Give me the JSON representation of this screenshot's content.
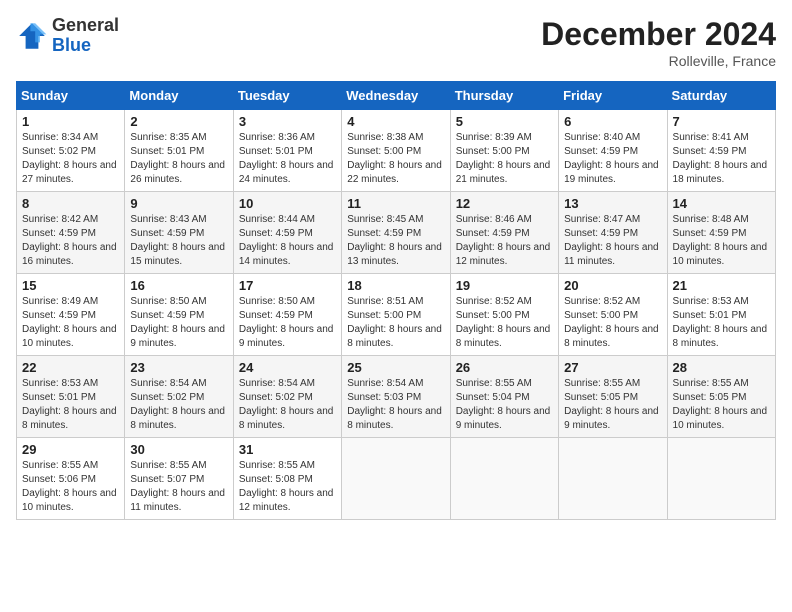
{
  "header": {
    "logo_line1": "General",
    "logo_line2": "Blue",
    "month": "December 2024",
    "location": "Rolleville, France"
  },
  "weekdays": [
    "Sunday",
    "Monday",
    "Tuesday",
    "Wednesday",
    "Thursday",
    "Friday",
    "Saturday"
  ],
  "weeks": [
    [
      {
        "day": "1",
        "sunrise": "8:34 AM",
        "sunset": "5:02 PM",
        "daylight": "8 hours and 27 minutes."
      },
      {
        "day": "2",
        "sunrise": "8:35 AM",
        "sunset": "5:01 PM",
        "daylight": "8 hours and 26 minutes."
      },
      {
        "day": "3",
        "sunrise": "8:36 AM",
        "sunset": "5:01 PM",
        "daylight": "8 hours and 24 minutes."
      },
      {
        "day": "4",
        "sunrise": "8:38 AM",
        "sunset": "5:00 PM",
        "daylight": "8 hours and 22 minutes."
      },
      {
        "day": "5",
        "sunrise": "8:39 AM",
        "sunset": "5:00 PM",
        "daylight": "8 hours and 21 minutes."
      },
      {
        "day": "6",
        "sunrise": "8:40 AM",
        "sunset": "4:59 PM",
        "daylight": "8 hours and 19 minutes."
      },
      {
        "day": "7",
        "sunrise": "8:41 AM",
        "sunset": "4:59 PM",
        "daylight": "8 hours and 18 minutes."
      }
    ],
    [
      {
        "day": "8",
        "sunrise": "8:42 AM",
        "sunset": "4:59 PM",
        "daylight": "8 hours and 16 minutes."
      },
      {
        "day": "9",
        "sunrise": "8:43 AM",
        "sunset": "4:59 PM",
        "daylight": "8 hours and 15 minutes."
      },
      {
        "day": "10",
        "sunrise": "8:44 AM",
        "sunset": "4:59 PM",
        "daylight": "8 hours and 14 minutes."
      },
      {
        "day": "11",
        "sunrise": "8:45 AM",
        "sunset": "4:59 PM",
        "daylight": "8 hours and 13 minutes."
      },
      {
        "day": "12",
        "sunrise": "8:46 AM",
        "sunset": "4:59 PM",
        "daylight": "8 hours and 12 minutes."
      },
      {
        "day": "13",
        "sunrise": "8:47 AM",
        "sunset": "4:59 PM",
        "daylight": "8 hours and 11 minutes."
      },
      {
        "day": "14",
        "sunrise": "8:48 AM",
        "sunset": "4:59 PM",
        "daylight": "8 hours and 10 minutes."
      }
    ],
    [
      {
        "day": "15",
        "sunrise": "8:49 AM",
        "sunset": "4:59 PM",
        "daylight": "8 hours and 10 minutes."
      },
      {
        "day": "16",
        "sunrise": "8:50 AM",
        "sunset": "4:59 PM",
        "daylight": "8 hours and 9 minutes."
      },
      {
        "day": "17",
        "sunrise": "8:50 AM",
        "sunset": "4:59 PM",
        "daylight": "8 hours and 9 minutes."
      },
      {
        "day": "18",
        "sunrise": "8:51 AM",
        "sunset": "5:00 PM",
        "daylight": "8 hours and 8 minutes."
      },
      {
        "day": "19",
        "sunrise": "8:52 AM",
        "sunset": "5:00 PM",
        "daylight": "8 hours and 8 minutes."
      },
      {
        "day": "20",
        "sunrise": "8:52 AM",
        "sunset": "5:00 PM",
        "daylight": "8 hours and 8 minutes."
      },
      {
        "day": "21",
        "sunrise": "8:53 AM",
        "sunset": "5:01 PM",
        "daylight": "8 hours and 8 minutes."
      }
    ],
    [
      {
        "day": "22",
        "sunrise": "8:53 AM",
        "sunset": "5:01 PM",
        "daylight": "8 hours and 8 minutes."
      },
      {
        "day": "23",
        "sunrise": "8:54 AM",
        "sunset": "5:02 PM",
        "daylight": "8 hours and 8 minutes."
      },
      {
        "day": "24",
        "sunrise": "8:54 AM",
        "sunset": "5:02 PM",
        "daylight": "8 hours and 8 minutes."
      },
      {
        "day": "25",
        "sunrise": "8:54 AM",
        "sunset": "5:03 PM",
        "daylight": "8 hours and 8 minutes."
      },
      {
        "day": "26",
        "sunrise": "8:55 AM",
        "sunset": "5:04 PM",
        "daylight": "8 hours and 9 minutes."
      },
      {
        "day": "27",
        "sunrise": "8:55 AM",
        "sunset": "5:05 PM",
        "daylight": "8 hours and 9 minutes."
      },
      {
        "day": "28",
        "sunrise": "8:55 AM",
        "sunset": "5:05 PM",
        "daylight": "8 hours and 10 minutes."
      }
    ],
    [
      {
        "day": "29",
        "sunrise": "8:55 AM",
        "sunset": "5:06 PM",
        "daylight": "8 hours and 10 minutes."
      },
      {
        "day": "30",
        "sunrise": "8:55 AM",
        "sunset": "5:07 PM",
        "daylight": "8 hours and 11 minutes."
      },
      {
        "day": "31",
        "sunrise": "8:55 AM",
        "sunset": "5:08 PM",
        "daylight": "8 hours and 12 minutes."
      },
      null,
      null,
      null,
      null
    ]
  ]
}
